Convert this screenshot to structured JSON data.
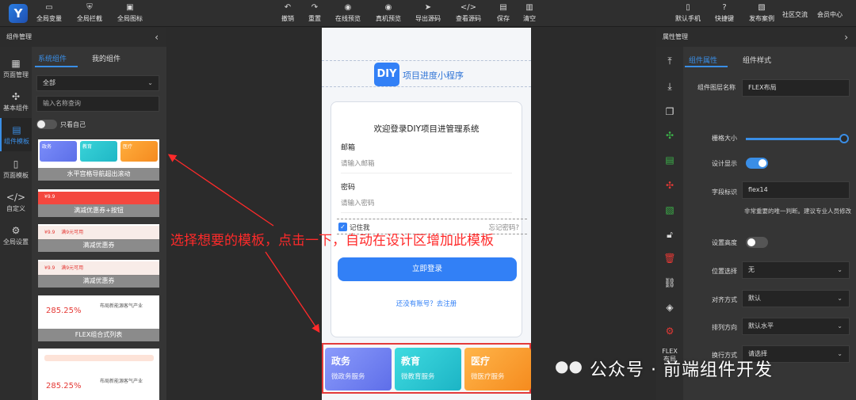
{
  "topbar": {
    "left": [
      "全局变量",
      "全局拦截",
      "全局图标"
    ],
    "center": [
      "撤销",
      "重置",
      "在线预览",
      "真机预览",
      "导出源码",
      "查看源码",
      "保存",
      "清空"
    ],
    "right": [
      "默认手机",
      "快捷键",
      "发布案例",
      "社区交流",
      "会员中心"
    ]
  },
  "left_panel": {
    "title": "组件管理",
    "nav": [
      "页面管理",
      "基本组件",
      "组件模板",
      "页面模板",
      "自定义",
      "全局设置"
    ],
    "tabs": [
      "系统组件",
      "我的组件"
    ],
    "filter_value": "全部",
    "search_placeholder": "输入名称查询",
    "toggle_label": "只看自己",
    "templates": {
      "t1": {
        "caption": "水平宫格导航超出滚动",
        "cards": [
          "政务",
          "教育",
          "医疗"
        ]
      },
      "t2": {
        "caption": "满减优惠券+按钮",
        "price": "¥9.9"
      },
      "t3": {
        "caption": "满减优惠券",
        "price": "¥9.9",
        "rule": "满9元可用"
      },
      "t4": {
        "caption": "满减优惠券",
        "price": "¥9.9",
        "rule": "满9元可用"
      },
      "t5": {
        "caption": "FLEX组合式列表",
        "pct": "285.25%",
        "heading": "布局新能源客气产业"
      },
      "t6": {
        "pct": "285.25%",
        "heading": "布局新能源客气产业"
      }
    }
  },
  "phone": {
    "app_badge": "DIY",
    "app_title": "项目进度小程序",
    "login_title": "欢迎登录DIY项目进管理系统",
    "email_label": "邮箱",
    "email_placeholder": "请输入邮箱",
    "password_label": "密码",
    "password_placeholder": "请输入密码",
    "remember_label": "记住我",
    "forgot_label": "忘记密码?",
    "login_button": "立即登录",
    "register_link": "还没有账号？去注册",
    "categories": [
      {
        "title": "政务",
        "sub": "微政务服务"
      },
      {
        "title": "教育",
        "sub": "微教育服务"
      },
      {
        "title": "医疗",
        "sub": "微医疗服务"
      }
    ]
  },
  "annotation": "选择想要的模板，点击一下，自动在设计区增加此模板",
  "right_panel": {
    "title": "属性管理",
    "tabs": [
      "组件属性",
      "组件样式"
    ],
    "flex_label": "FLEX\n布局",
    "props": {
      "layer_name_label": "组件图层名称",
      "layer_name_value": "FLEX布局",
      "grid_size_label": "栅格大小",
      "design_show_label": "设计显示",
      "field_id_label": "字段标识",
      "field_id_value": "flex14",
      "field_note": "非常重要的唯一判断。建议专业人员修改",
      "set_height_label": "设置高度",
      "position_label": "位置选择",
      "position_value": "无",
      "align_label": "对齐方式",
      "align_value": "默认",
      "direction_label": "排列方向",
      "direction_value": "默认水平",
      "wrap_label": "换行方式",
      "wrap_value": "请选择"
    }
  },
  "watermark": "公众号 · 前端组件开发",
  "colors": {
    "accent": "#3a8ee6",
    "primary": "#3280f6",
    "annotation": "#ff2a2a"
  }
}
